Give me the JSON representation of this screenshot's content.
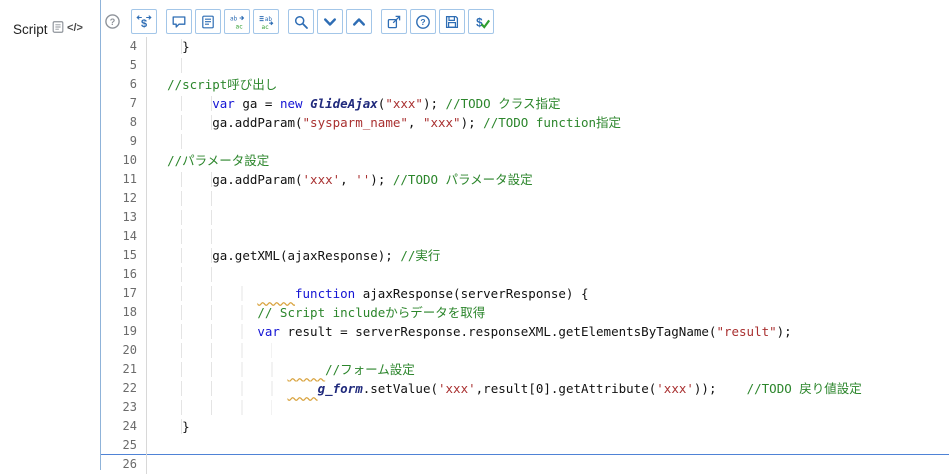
{
  "field": {
    "label": "Script"
  },
  "field_icons": [
    {
      "name": "script-document-icon",
      "icon": "script-doc"
    },
    {
      "name": "code-toggle-icon",
      "icon": "code-glyph"
    }
  ],
  "toolbar": {
    "groups": [
      {
        "buttons": [
          {
            "name": "context-help-button",
            "icon": "help-gray",
            "plain": true
          }
        ]
      },
      {
        "buttons": [
          {
            "name": "format-code-button",
            "icon": "script-swap"
          }
        ]
      },
      {
        "buttons": [
          {
            "name": "comment-code-button",
            "icon": "comment-bubble"
          },
          {
            "name": "document-format-button",
            "icon": "doc-lines"
          },
          {
            "name": "replace-button",
            "icon": "replace"
          },
          {
            "name": "replace-all-button",
            "icon": "replace-all"
          }
        ]
      },
      {
        "buttons": [
          {
            "name": "search-button",
            "icon": "search"
          },
          {
            "name": "find-next-button",
            "icon": "chevron-down"
          },
          {
            "name": "find-previous-button",
            "icon": "chevron-up"
          }
        ]
      },
      {
        "buttons": [
          {
            "name": "open-new-window-button",
            "icon": "pop-out"
          },
          {
            "name": "help-button",
            "icon": "help-circle"
          },
          {
            "name": "save-button",
            "icon": "floppy-disk"
          },
          {
            "name": "check-syntax-button",
            "icon": "dollar-check"
          }
        ]
      }
    ]
  },
  "editor": {
    "first_line": 4,
    "active_line": 25,
    "lines": [
      {
        "num": 4,
        "tokens": [
          {
            "c": "ws",
            "n": 4
          },
          {
            "c": "plain",
            "t": "}"
          }
        ]
      },
      {
        "num": 5,
        "tokens": [
          {
            "c": "ws",
            "n": 4
          }
        ]
      },
      {
        "num": 6,
        "tokens": [
          {
            "c": "ws",
            "n": 2
          },
          {
            "c": "com",
            "t": "//script呼び出し"
          }
        ]
      },
      {
        "num": 7,
        "tokens": [
          {
            "c": "ws",
            "n": 8
          },
          {
            "c": "kw",
            "t": "var"
          },
          {
            "c": "plain",
            "t": " ga = "
          },
          {
            "c": "kw",
            "t": "new"
          },
          {
            "c": "plain",
            "t": " "
          },
          {
            "c": "cls",
            "t": "GlideAjax"
          },
          {
            "c": "plain",
            "t": "("
          },
          {
            "c": "str",
            "t": "\"xxx\""
          },
          {
            "c": "plain",
            "t": "); "
          },
          {
            "c": "com",
            "t": "//TODO クラス指定"
          }
        ]
      },
      {
        "num": 8,
        "tokens": [
          {
            "c": "ws",
            "n": 8
          },
          {
            "c": "plain",
            "t": "ga.addParam("
          },
          {
            "c": "str",
            "t": "\"sysparm_name\""
          },
          {
            "c": "plain",
            "t": ", "
          },
          {
            "c": "str",
            "t": "\"xxx\""
          },
          {
            "c": "plain",
            "t": "); "
          },
          {
            "c": "com",
            "t": "//TODO function指定"
          }
        ]
      },
      {
        "num": 9,
        "tokens": [
          {
            "c": "ws",
            "n": 4
          }
        ]
      },
      {
        "num": 10,
        "tokens": [
          {
            "c": "ws",
            "n": 2
          },
          {
            "c": "com",
            "t": "//パラメータ設定"
          }
        ]
      },
      {
        "num": 11,
        "tokens": [
          {
            "c": "ws",
            "n": 8
          },
          {
            "c": "plain",
            "t": "ga.addParam("
          },
          {
            "c": "str",
            "t": "'xxx'"
          },
          {
            "c": "plain",
            "t": ", "
          },
          {
            "c": "str",
            "t": "''"
          },
          {
            "c": "plain",
            "t": "); "
          },
          {
            "c": "com",
            "t": "//TODO パラメータ設定"
          }
        ]
      },
      {
        "num": 12,
        "tokens": [
          {
            "c": "ws",
            "n": 8
          }
        ]
      },
      {
        "num": 13,
        "tokens": [
          {
            "c": "ws",
            "n": 8
          }
        ]
      },
      {
        "num": 14,
        "tokens": [
          {
            "c": "ws",
            "n": 8
          }
        ]
      },
      {
        "num": 15,
        "tokens": [
          {
            "c": "ws",
            "n": 8
          },
          {
            "c": "plain",
            "t": "ga.getXML(ajaxResponse); "
          },
          {
            "c": "com",
            "t": "//実行"
          }
        ]
      },
      {
        "num": 16,
        "tokens": [
          {
            "c": "ws",
            "n": 8
          }
        ]
      },
      {
        "num": 17,
        "tokens": [
          {
            "c": "ws",
            "n": 14
          },
          {
            "c": "warn",
            "n": 5
          },
          {
            "c": "kw",
            "t": "function"
          },
          {
            "c": "plain",
            "t": " ajaxResponse(serverResponse) {"
          }
        ]
      },
      {
        "num": 18,
        "tokens": [
          {
            "c": "ws",
            "n": 14
          },
          {
            "c": "com",
            "t": "// Script includeからデータを取得"
          }
        ]
      },
      {
        "num": 19,
        "tokens": [
          {
            "c": "ws",
            "n": 14
          },
          {
            "c": "kw",
            "t": "var"
          },
          {
            "c": "plain",
            "t": " result = serverResponse.responseXML.getElementsByTagName("
          },
          {
            "c": "str",
            "t": "\"result\""
          },
          {
            "c": "plain",
            "t": ");"
          }
        ]
      },
      {
        "num": 20,
        "tokens": [
          {
            "c": "ws",
            "n": 16
          }
        ]
      },
      {
        "num": 21,
        "tokens": [
          {
            "c": "ws",
            "n": 18
          },
          {
            "c": "warn",
            "n": 5
          },
          {
            "c": "com",
            "t": "//フォーム設定"
          }
        ]
      },
      {
        "num": 22,
        "tokens": [
          {
            "c": "ws",
            "n": 18
          },
          {
            "c": "warn",
            "n": 4
          },
          {
            "c": "cls",
            "t": "g_form"
          },
          {
            "c": "plain",
            "t": ".setValue("
          },
          {
            "c": "str",
            "t": "'xxx'"
          },
          {
            "c": "plain",
            "t": ",result[0].getAttribute("
          },
          {
            "c": "str",
            "t": "'xxx'"
          },
          {
            "c": "plain",
            "t": "));    "
          },
          {
            "c": "com",
            "t": "//TODO 戻り値設定"
          }
        ]
      },
      {
        "num": 23,
        "tokens": [
          {
            "c": "ws",
            "n": 16
          }
        ]
      },
      {
        "num": 24,
        "tokens": [
          {
            "c": "ws",
            "n": 4
          },
          {
            "c": "plain",
            "t": "}"
          }
        ]
      },
      {
        "num": 25,
        "tokens": []
      },
      {
        "num": 26,
        "tokens": []
      }
    ]
  },
  "colors": {
    "accent_blue": "#2e6db4",
    "keyword": "#1414d4",
    "string": "#a93030",
    "comment": "#2c862c",
    "class_ref": "#202a7c",
    "warning_underline": "#d9a441",
    "active_line": "#4f83d6"
  }
}
